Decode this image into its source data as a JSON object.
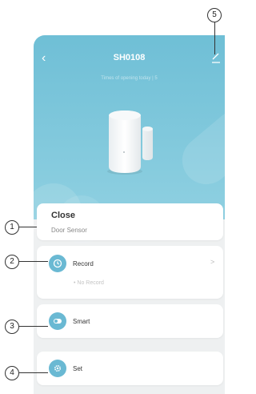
{
  "header": {
    "title": "SH0108",
    "subtitle": "Times of opening today | 5"
  },
  "status": {
    "state": "Close",
    "device": "Door Sensor"
  },
  "rows": {
    "record": {
      "label": "Record",
      "empty_text": "• No Record"
    },
    "smart": {
      "label": "Smart"
    },
    "set": {
      "label": "Set"
    }
  },
  "callouts": [
    "1",
    "2",
    "3",
    "4",
    "5"
  ],
  "colors": {
    "header_bg": "#7cc6dc",
    "icon_bg": "#6ab9d3",
    "card_bg": "#ffffff",
    "page_bg": "#eef0f1"
  }
}
